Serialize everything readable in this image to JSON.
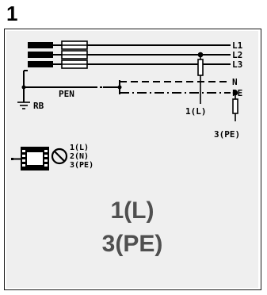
{
  "figure": {
    "number": "1"
  },
  "network": {
    "lines": [
      "L1",
      "L2",
      "L3",
      "N",
      "PE"
    ],
    "pen_label": "PEN",
    "earth_label": "RB",
    "probe_l_label": "1(L)",
    "probe_pe_label": "3(PE)"
  },
  "device": {
    "terminals": [
      "1(L)",
      "2(N)",
      "3(PE)"
    ]
  },
  "result": {
    "line1": "1(L)",
    "line2": "3(PE)"
  },
  "colors": {
    "frame": "#1a1a1a",
    "panel": "#efefef",
    "result_text": "#505050"
  }
}
